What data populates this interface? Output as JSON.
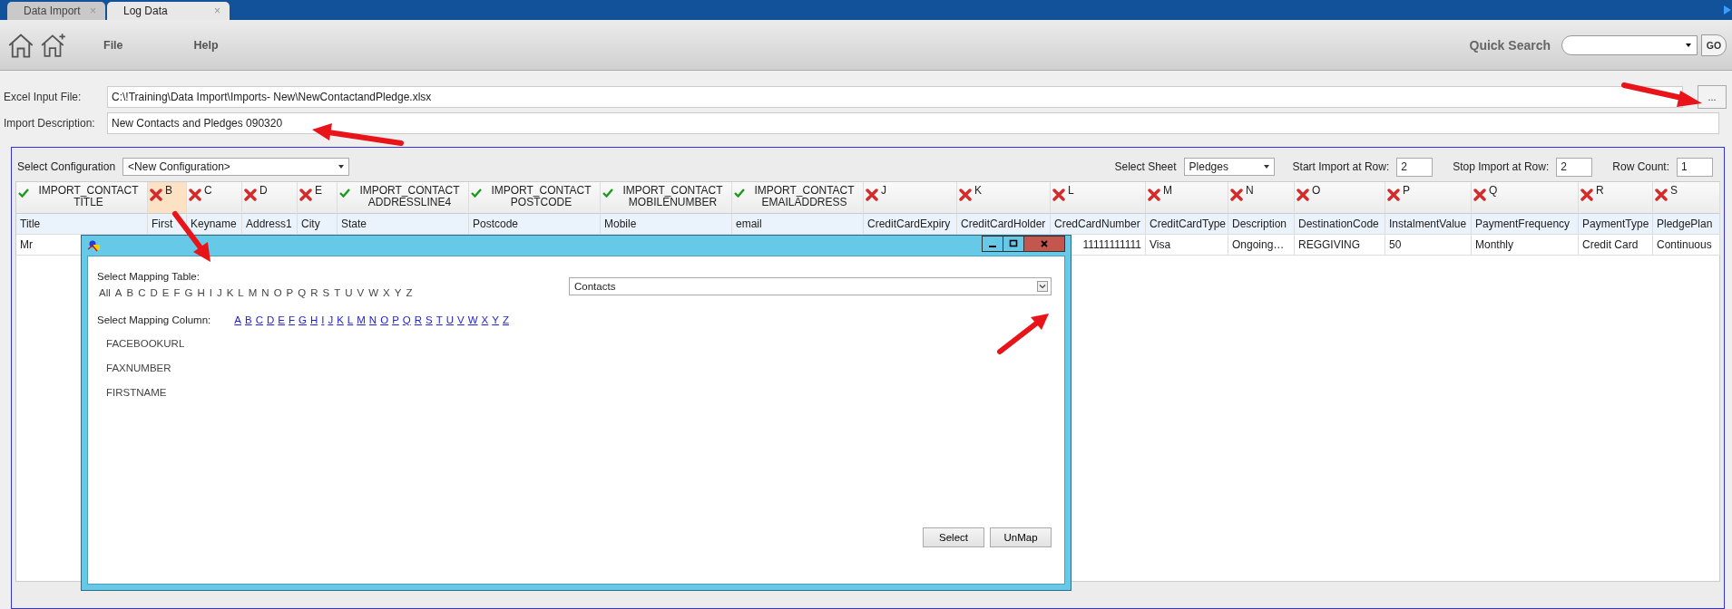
{
  "tabs": [
    {
      "label": "Data Import",
      "close": "×",
      "selected": false
    },
    {
      "label": "Log Data",
      "close": "×",
      "selected": true
    }
  ],
  "menu": [
    "File",
    "Help"
  ],
  "quick_search": {
    "label": "Quick Search",
    "button": "GO"
  },
  "form": {
    "excel_input": {
      "label": "Excel Input File:",
      "value": "C:\\!Training\\Data Import\\Imports- New\\NewContactandPledge.xlsx",
      "browse": "..."
    },
    "description": {
      "label": "Import Description:",
      "value": "New Contacts and Pledges 090320"
    }
  },
  "config": {
    "label": "Select Configuration",
    "value": "<New Configuration>"
  },
  "sheet": {
    "label": "Select Sheet",
    "value": "Pledges"
  },
  "start_row": {
    "label": "Start Import at Row:",
    "value": "2"
  },
  "stop_row": {
    "label": "Stop Import at Row:",
    "value": "2"
  },
  "row_count": {
    "label": "Row Count:",
    "value": "1"
  },
  "table": {
    "columns": [
      {
        "mapped": true,
        "heading": "IMPORT_CONTACT TITLE",
        "source": "Title",
        "selected": false
      },
      {
        "mapped": false,
        "heading": "B",
        "source": "First",
        "selected": true
      },
      {
        "mapped": false,
        "heading": "C",
        "source": "Keyname",
        "selected": false
      },
      {
        "mapped": false,
        "heading": "D",
        "source": "Address1",
        "selected": false
      },
      {
        "mapped": false,
        "heading": "E",
        "source": "City",
        "selected": false
      },
      {
        "mapped": true,
        "heading": "IMPORT_CONTACT ADDRESSLINE4",
        "source": "State",
        "selected": false
      },
      {
        "mapped": true,
        "heading": "IMPORT_CONTACT POSTCODE",
        "source": "Postcode",
        "selected": false
      },
      {
        "mapped": true,
        "heading": "IMPORT_CONTACT MOBILENUMBER",
        "source": "Mobile",
        "selected": false
      },
      {
        "mapped": true,
        "heading": "IMPORT_CONTACT EMAILADDRESS",
        "source": "email",
        "selected": false
      },
      {
        "mapped": false,
        "heading": "J",
        "source": "CreditCardExpiry",
        "selected": false
      },
      {
        "mapped": false,
        "heading": "K",
        "source": "CreditCardHolder",
        "selected": false
      },
      {
        "mapped": false,
        "heading": "L",
        "source": "CredCardNumber",
        "selected": false
      },
      {
        "mapped": false,
        "heading": "M",
        "source": "CreditCardType",
        "selected": false
      },
      {
        "mapped": false,
        "heading": "N",
        "source": "Description",
        "selected": false
      },
      {
        "mapped": false,
        "heading": "O",
        "source": "DestinationCode",
        "selected": false
      },
      {
        "mapped": false,
        "heading": "P",
        "source": "InstalmentValue",
        "selected": false
      },
      {
        "mapped": false,
        "heading": "Q",
        "source": "PaymentFrequency",
        "selected": false
      },
      {
        "mapped": false,
        "heading": "R",
        "source": "PaymentType",
        "selected": false
      },
      {
        "mapped": false,
        "heading": "S",
        "source": "PledgePlan",
        "selected": false
      }
    ],
    "rows": [
      [
        "Mr",
        null,
        null,
        null,
        null,
        null,
        null,
        null,
        null,
        null,
        null,
        "11111111111",
        "Visa",
        "Ongoing…",
        "REGGIVING",
        "50",
        "Monthly",
        "Credit Card",
        "Continuous"
      ]
    ]
  },
  "dialog": {
    "table_label": "Select Mapping Table:",
    "table_filters": [
      "All",
      "A",
      "B",
      "C",
      "D",
      "E",
      "F",
      "G",
      "H",
      "I",
      "J",
      "K",
      "L",
      "M",
      "N",
      "O",
      "P",
      "Q",
      "R",
      "S",
      "T",
      "U",
      "V",
      "W",
      "X",
      "Y",
      "Z"
    ],
    "table_value": "Contacts",
    "column_label": "Select Mapping Column:",
    "column_links": [
      "A",
      "B",
      "C",
      "D",
      "E",
      "F",
      "G",
      "H",
      "I",
      "J",
      "K",
      "L",
      "M",
      "N",
      "O",
      "P",
      "Q",
      "R",
      "S",
      "T",
      "U",
      "V",
      "W",
      "X",
      "Y",
      "Z"
    ],
    "fields": [
      "FACEBOOKURL",
      "FAXNUMBER",
      "FIRSTNAME"
    ],
    "buttons": [
      "Select",
      "UnMap"
    ]
  }
}
